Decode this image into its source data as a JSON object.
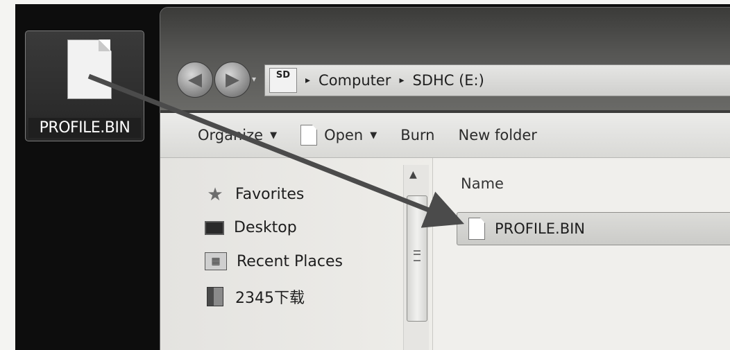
{
  "desktop": {
    "file_icon": {
      "icon": "document-icon",
      "label": "PROFILE.BIN"
    }
  },
  "window": {
    "nav": {
      "back_icon": "back-arrow-icon",
      "forward_icon": "forward-arrow-icon",
      "history_icon": "chevron-down-icon"
    },
    "address": {
      "drive_icon_text": "SD",
      "breadcrumb": [
        "Computer",
        "SDHC (E:)"
      ],
      "separator": "▸"
    },
    "toolbar": {
      "organize": "Organize",
      "open": "Open",
      "burn": "Burn",
      "new_folder": "New folder",
      "caret": "▼"
    },
    "navpane": {
      "items": [
        {
          "icon": "star-icon",
          "label": "Favorites"
        },
        {
          "icon": "desktop-icon",
          "label": "Desktop"
        },
        {
          "icon": "recent-places-icon",
          "label": "Recent Places"
        },
        {
          "icon": "folder-icon",
          "label": "2345下载"
        }
      ]
    },
    "filelist": {
      "column_name": "Name",
      "files": [
        {
          "icon": "document-icon",
          "name": "PROFILE.BIN",
          "selected": true
        }
      ]
    }
  },
  "colors": {
    "arrow": "#4b4b4b",
    "desktop": "#0d0d0d"
  }
}
